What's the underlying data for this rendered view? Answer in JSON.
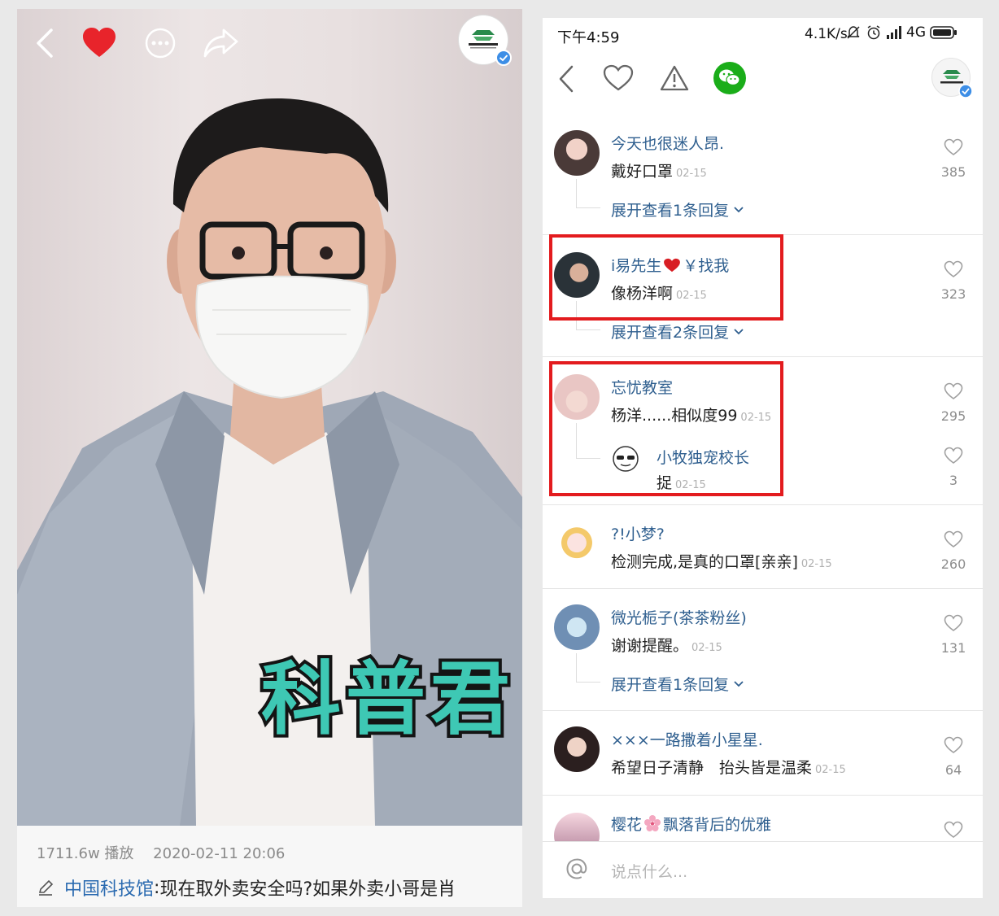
{
  "left_panel": {
    "video": {
      "caption_overlay": "科普君"
    },
    "info": {
      "play_count": "1711.6w 播放",
      "datetime": "2020-02-11 20:06",
      "author": "中国科技馆",
      "separator": ":",
      "description": "现在取外卖安全吗?如果外卖小哥是肖"
    }
  },
  "right_panel": {
    "status_bar": {
      "time": "下午4:59",
      "network_speed": "4.1K/s",
      "network_type": "4G"
    },
    "comments": [
      {
        "user": "今天也很迷人昂.",
        "text": "戴好口罩",
        "date": "02-15",
        "likes": "385",
        "expand": "展开查看1条回复"
      },
      {
        "user_prefix": "i易先生",
        "user_suffix": "￥找我",
        "text": "像杨洋啊",
        "date": "02-15",
        "likes": "323",
        "expand": "展开查看2条回复"
      },
      {
        "user": "忘忧教室",
        "text": "杨洋......相似度99",
        "date": "02-15",
        "likes": "295",
        "reply": {
          "user": "小牧独宠校长",
          "text": "捉",
          "date": "02-15",
          "likes": "3"
        }
      },
      {
        "user": "?!小梦?",
        "text": "检测完成,是真的口罩[亲亲]",
        "date": "02-15",
        "likes": "260"
      },
      {
        "user": "微光栀子(茶茶粉丝)",
        "text": "谢谢提醒。",
        "date": "02-15",
        "likes": "131",
        "expand": "展开查看1条回复"
      },
      {
        "user": "×××一路撒着小星星.",
        "text": "希望日子清静　抬头皆是温柔",
        "date": "02-15",
        "likes": "64"
      },
      {
        "user_prefix": "樱花",
        "user_suffix": "飘落背后的优雅",
        "text": "",
        "date": "",
        "likes": ""
      }
    ],
    "input_placeholder": "说点什么..."
  },
  "colors": {
    "username_blue": "#2f5f8f",
    "highlight_red": "#e31b1e",
    "wechat_green": "#1aad19",
    "caption_teal": "#3ec8b4",
    "heart_red": "#e8242b"
  }
}
